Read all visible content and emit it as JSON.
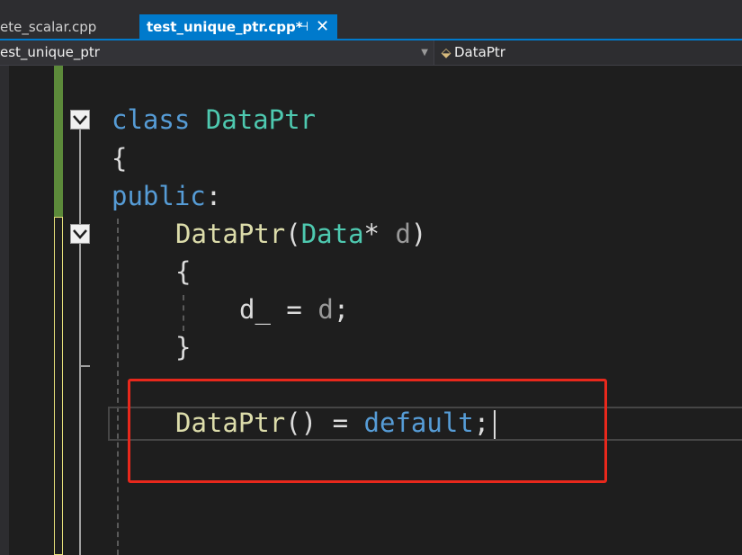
{
  "tabs": {
    "inactive_label": "ete_scalar.cpp",
    "active_label": "test_unique_ptr.cpp*",
    "pin_glyph": "⊣",
    "close_glyph": "✕"
  },
  "navbar": {
    "scope": "est_unique_ptr",
    "member": "DataPtr"
  },
  "code": {
    "l1_kw": "class",
    "l1_name": "DataPtr",
    "l2_brace": "{",
    "l3_access": "public",
    "l3_colon": ":",
    "l4_fn": "DataPtr",
    "l4_open": "(",
    "l4_type": "Data",
    "l4_star": "* ",
    "l4_param": "d",
    "l4_close": ")",
    "l5_brace": "{",
    "l6_member": "d_ = ",
    "l6_param": "d",
    "l6_semi": ";",
    "l7_brace": "}",
    "l8_fn": "DataPtr",
    "l8_parens": "() = ",
    "l8_kw": "default",
    "l8_semi": ";"
  },
  "colors": {
    "keyword": "#569cd6",
    "type": "#4ec9b0",
    "function": "#dcdcaa",
    "highlight": "#e8281c",
    "tab_active": "#007acc"
  }
}
